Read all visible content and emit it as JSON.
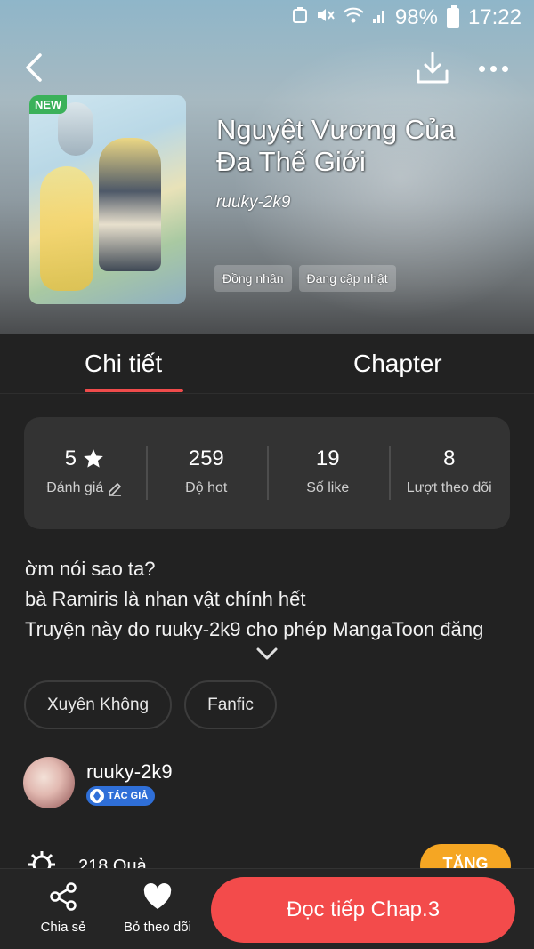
{
  "status_bar": {
    "battery": "98%",
    "time": "17:22"
  },
  "comic": {
    "title_line1": "Nguyệt Vương Của",
    "title_line2": "Đa Thế Giới",
    "author": "ruuky-2k9",
    "new_badge": "NEW",
    "genres": [
      "Đồng nhân",
      "Đang cập nhật"
    ]
  },
  "tabs": {
    "detail": "Chi tiết",
    "chapter": "Chapter"
  },
  "stats": [
    {
      "value": "5",
      "label": "Đánh giá"
    },
    {
      "value": "259",
      "label": "Độ hot"
    },
    {
      "value": "19",
      "label": "Số like"
    },
    {
      "value": "8",
      "label": "Lượt theo dõi"
    }
  ],
  "description": [
    "ờm nói sao ta?",
    "bà Ramiris là nhan vật chính hết",
    "Truyện này do ruuky-2k9 cho phép MangaToon đăng"
  ],
  "categories": [
    "Xuyên Không",
    "Fanfic"
  ],
  "author_section": {
    "name": "ruuky-2k9",
    "badge": "TÁC GIẢ"
  },
  "gifts": {
    "count": "218  Quà",
    "button": "TẶNG"
  },
  "bottom_bar": {
    "share": "Chia sẻ",
    "unfollow": "Bỏ theo dõi",
    "read": "Đọc tiếp Chap.3"
  },
  "colors": {
    "accent": "#f34b4b",
    "tab_underline": "#ef4b4b",
    "gift": "#f5a623",
    "new_badge": "#3bb15a",
    "author_badge": "#2f6fd8"
  }
}
